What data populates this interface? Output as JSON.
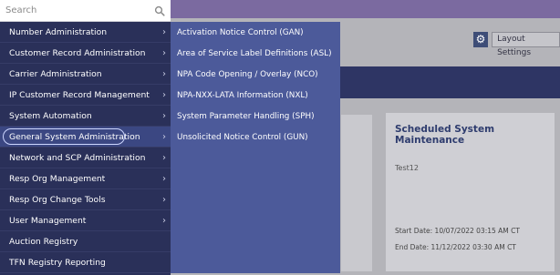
{
  "search": {
    "placeholder": "Search"
  },
  "menu": {
    "items": [
      {
        "label": "Number Administration",
        "has_submenu": true
      },
      {
        "label": "Customer Record Administration",
        "has_submenu": true
      },
      {
        "label": "Carrier Administration",
        "has_submenu": true
      },
      {
        "label": "IP Customer Record Management",
        "has_submenu": true
      },
      {
        "label": "System Automation",
        "has_submenu": true
      },
      {
        "label": "General System Administration",
        "has_submenu": true,
        "active": true
      },
      {
        "label": "Network and SCP Administration",
        "has_submenu": true
      },
      {
        "label": "Resp Org Management",
        "has_submenu": true
      },
      {
        "label": "Resp Org Change Tools",
        "has_submenu": true
      },
      {
        "label": "User Management",
        "has_submenu": true
      },
      {
        "label": "Auction Registry",
        "has_submenu": false
      },
      {
        "label": "TFN Registry Reporting",
        "has_submenu": false
      }
    ],
    "chevron": "›"
  },
  "submenu": {
    "items": [
      {
        "label": "Activation Notice Control (GAN)"
      },
      {
        "label": "Area of Service Label Definitions (ASL)"
      },
      {
        "label": "NPA Code Opening / Overlay (NCO)"
      },
      {
        "label": "NPA-NXX-LATA Information (NXL)"
      },
      {
        "label": "System Parameter Handling (SPH)"
      },
      {
        "label": "Unsolicited Notice Control (GUN)"
      }
    ]
  },
  "toolbar": {
    "layout_settings_label": "Layout Settings",
    "gear_icon": "⚙"
  },
  "card": {
    "title": "Scheduled System Maintenance",
    "text": "Test12",
    "start_date": "Start Date: 10/07/2022 03:15 AM CT",
    "end_date": "End Date: 11/12/2022 03:30 AM CT"
  },
  "colors": {
    "menu_bg": "#2a3059",
    "submenu_bg": "#4c5a9a",
    "active_ring": "#cdd6ff",
    "header_purple": "#7b6aa0",
    "card_title": "#2e3c6e"
  }
}
